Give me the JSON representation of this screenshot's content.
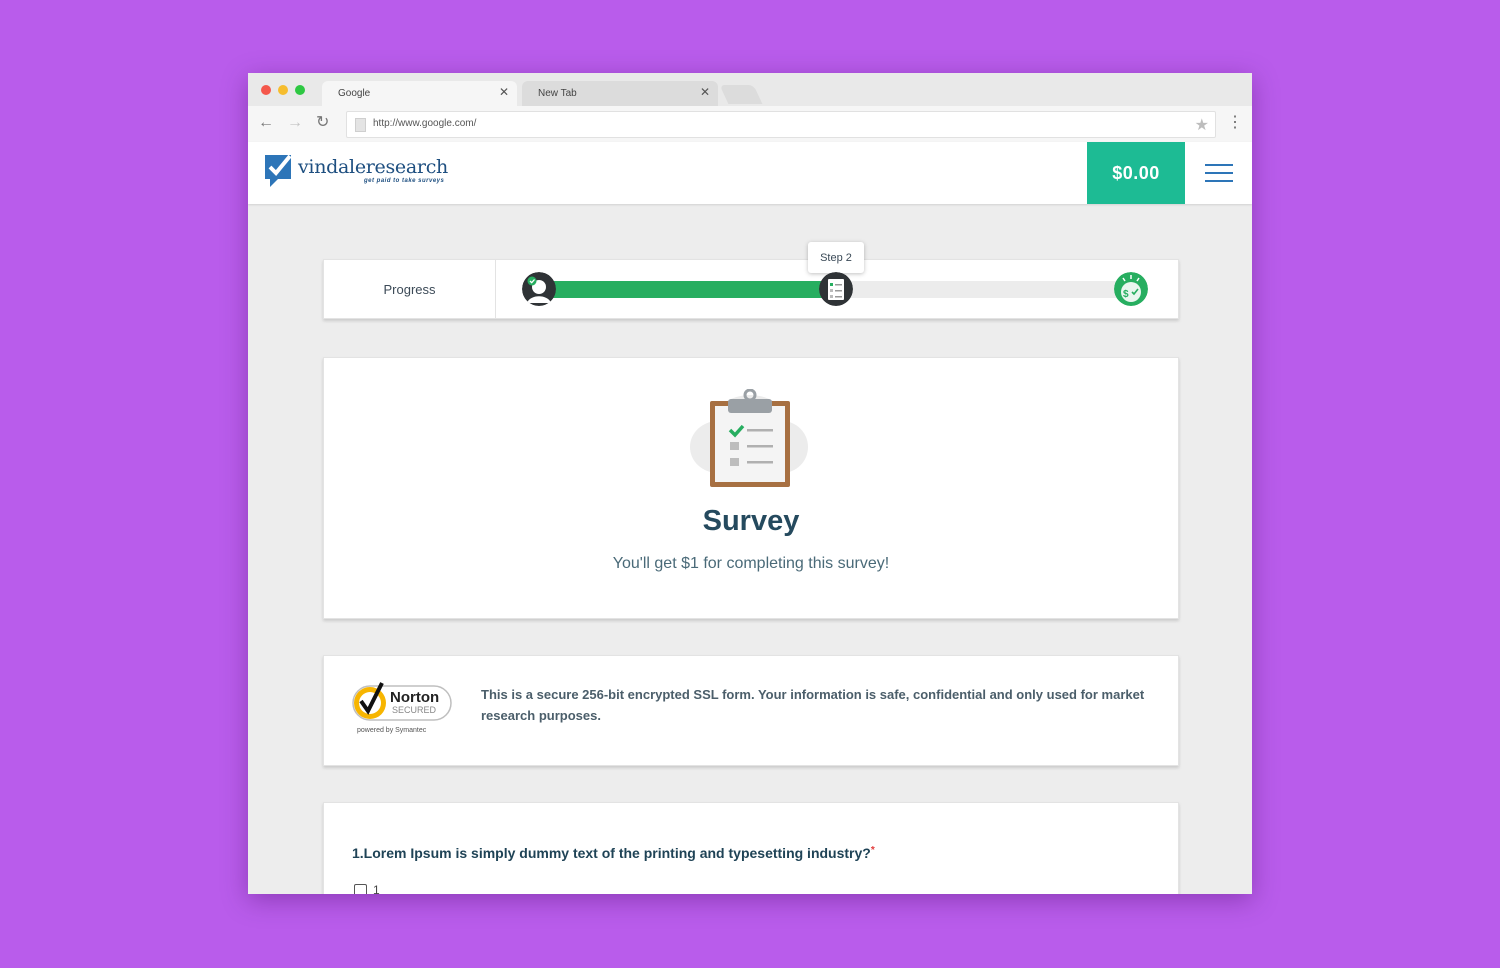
{
  "browser": {
    "tabs": [
      {
        "title": "Google",
        "active": true
      },
      {
        "title": "New Tab",
        "active": false
      }
    ],
    "url": "http://www.google.com/"
  },
  "header": {
    "logo_text": "vindaleresearch",
    "logo_tagline": "get paid to take surveys",
    "balance": "$0.00"
  },
  "progress": {
    "label": "Progress",
    "current_step_label": "Step 2",
    "fill_fraction": 0.5
  },
  "survey": {
    "title": "Survey",
    "subtitle": "You'll get $1 for completing this survey!"
  },
  "security": {
    "badge_brand": "Norton",
    "badge_secured": "SECURED",
    "badge_powered": "powered by Symantec",
    "message": "This is a secure 256-bit encrypted SSL form. Your information is safe, confidential and only used for market research purposes."
  },
  "question": {
    "text": "1.Lorem Ipsum is simply dummy text of the printing and typesetting industry?",
    "required_mark": "*",
    "options": [
      "1"
    ]
  },
  "colors": {
    "background": "#b95ceb",
    "brand_green": "#1dbb94",
    "progress_green": "#27ae60",
    "brand_blue": "#1e4f80"
  }
}
